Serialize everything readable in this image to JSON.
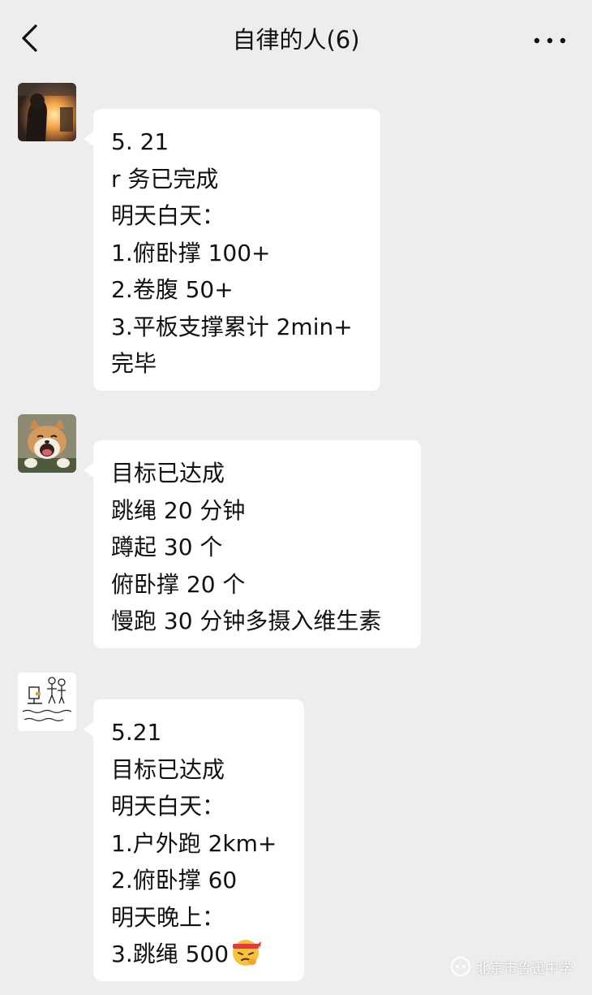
{
  "header": {
    "title": "自律的人(6)",
    "back_icon": "chevron-left-icon",
    "more_icon": "more-dots-icon"
  },
  "messages": [
    {
      "avatar": "avatar-sunset-portrait",
      "lines": [
        "5. 21",
        "r 务已完成",
        "明天白天：",
        "1.俯卧撑 100+",
        "2.卷腹 50+",
        "3.平板支撑累计 2min+",
        "完毕"
      ]
    },
    {
      "avatar": "avatar-shiba-dog",
      "lines": [
        "目标已达成",
        "跳绳 20 分钟",
        "蹲起 30 个",
        "俯卧撑 20 个",
        "慢跑 30 分钟多摄入维生素"
      ]
    },
    {
      "avatar": "avatar-sketch-drawing",
      "lines": [
        "5.21",
        "目标已达成",
        "明天白天：",
        "1.户外跑 2km+",
        "2.俯卧撑 60",
        "明天晚上：",
        "3.跳绳 500"
      ],
      "trailing_emoji": "determined-face-emoji"
    }
  ],
  "watermark": {
    "text": "北京市鲁迅中学",
    "icon": "wechat-official-icon"
  },
  "colors": {
    "background": "#ededed",
    "bubble": "#ffffff",
    "text": "#111111"
  }
}
